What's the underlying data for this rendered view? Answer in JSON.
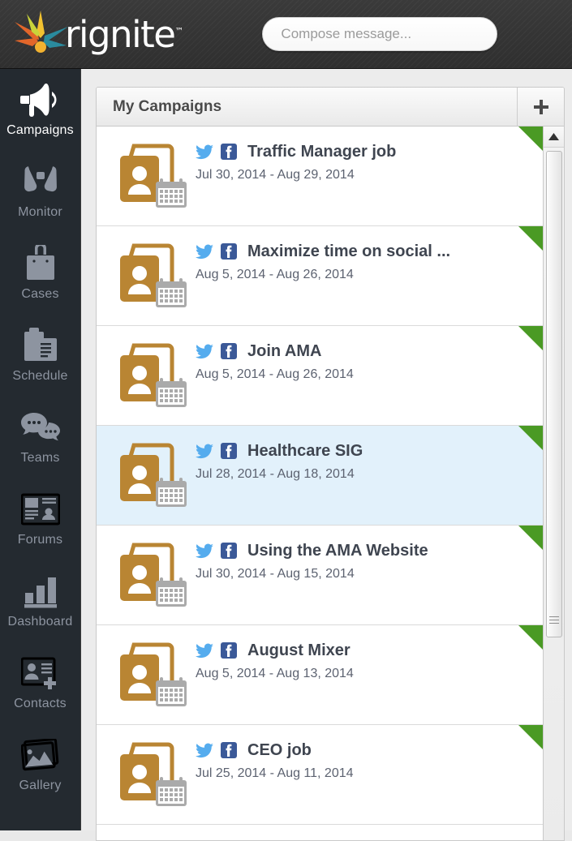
{
  "header": {
    "logo_text": "rignite",
    "logo_tm": "™",
    "logo_icon": "starburst-logo-icon",
    "compose": {
      "placeholder": "Compose message...",
      "value": ""
    }
  },
  "sidebar": {
    "items": [
      {
        "label": "Campaigns",
        "icon": "megaphone-icon",
        "active": true
      },
      {
        "label": "Monitor",
        "icon": "binoculars-icon",
        "active": false
      },
      {
        "label": "Cases",
        "icon": "briefcase-icon",
        "active": false
      },
      {
        "label": "Schedule",
        "icon": "clipboard-icon",
        "active": false
      },
      {
        "label": "Teams",
        "icon": "chat-bubbles-icon",
        "active": false
      },
      {
        "label": "Forums",
        "icon": "forums-icon",
        "active": false
      },
      {
        "label": "Dashboard",
        "icon": "bar-chart-icon",
        "active": false
      },
      {
        "label": "Contacts",
        "icon": "contact-add-icon",
        "active": false
      },
      {
        "label": "Gallery",
        "icon": "image-icon",
        "active": false
      }
    ]
  },
  "panel": {
    "title": "My Campaigns",
    "add_button_icon": "plus-icon",
    "add_button_label": "+"
  },
  "colors": {
    "accent_green": "#4a9a24",
    "twitter_blue": "#55acee",
    "facebook_blue": "#3b5998",
    "campaign_icon_brown": "#b98533",
    "selected_row": "#e2f1fb",
    "sidebar_bg": "#242a30",
    "header_bg": "#333333"
  },
  "campaigns": [
    {
      "title": "Traffic Manager job",
      "dates": "Jul 30, 2014 - Aug 29, 2014",
      "networks": [
        "twitter",
        "facebook"
      ],
      "selected": false,
      "corner": "»"
    },
    {
      "title": "Maximize time on social ...",
      "dates": "Aug 5, 2014 - Aug 26, 2014",
      "networks": [
        "twitter",
        "facebook"
      ],
      "selected": false,
      "corner": "»"
    },
    {
      "title": "Join AMA",
      "dates": "Aug 5, 2014 - Aug 26, 2014",
      "networks": [
        "twitter",
        "facebook"
      ],
      "selected": false,
      "corner": "»"
    },
    {
      "title": "Healthcare SIG",
      "dates": "Jul 28, 2014 - Aug 18, 2014",
      "networks": [
        "twitter",
        "facebook"
      ],
      "selected": true,
      "corner": "»"
    },
    {
      "title": "Using the AMA Website",
      "dates": "Jul 30, 2014 - Aug 15, 2014",
      "networks": [
        "twitter",
        "facebook"
      ],
      "selected": false,
      "corner": "»"
    },
    {
      "title": "August Mixer",
      "dates": "Aug 5, 2014 - Aug 13, 2014",
      "networks": [
        "twitter",
        "facebook"
      ],
      "selected": false,
      "corner": "»"
    },
    {
      "title": "CEO job",
      "dates": "Jul 25, 2014 - Aug 11, 2014",
      "networks": [
        "twitter",
        "facebook"
      ],
      "selected": false,
      "corner": "»"
    }
  ]
}
